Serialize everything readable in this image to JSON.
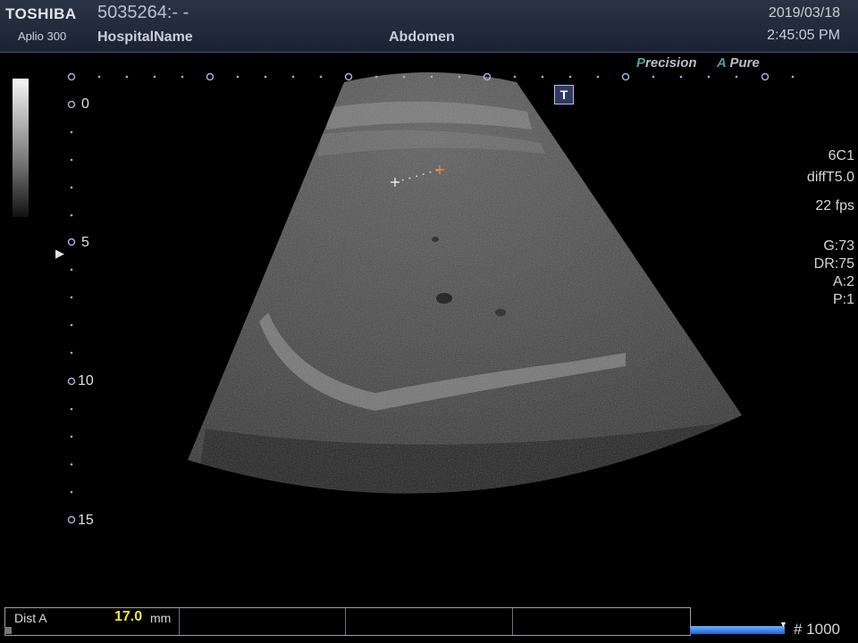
{
  "header": {
    "brand": "TOSHIBA",
    "model": "Aplio 300",
    "patient_id": "5035264:- -",
    "hospital": "HospitalName",
    "exam": "Abdomen",
    "date": "2019/03/18",
    "time": "2:45:05 PM"
  },
  "processing": {
    "precision_letter": "P",
    "precision_rest": "recision",
    "apure_letter": "A",
    "apure_rest": "Pure"
  },
  "depth_scale": {
    "labels": [
      "0",
      "5",
      "10",
      "15"
    ]
  },
  "icons": {
    "focus": "focus-marker-icon",
    "t_marker": "t-marker-icon"
  },
  "t_marker_label": "T",
  "params": {
    "probe": "6C1",
    "mode": "diffT5.0",
    "fps": "22 fps",
    "gain": "G:73",
    "dr": "DR:75",
    "a": "A:2",
    "p": "P:1"
  },
  "measurement": {
    "label": "Dist A",
    "value": "17.0",
    "unit": "mm"
  },
  "cine": {
    "progress": 1.0,
    "frame_counter": "# 1000"
  },
  "colors": {
    "accent": "#47a0a8",
    "measure": "#f2e92c",
    "header": "#1b2233"
  }
}
